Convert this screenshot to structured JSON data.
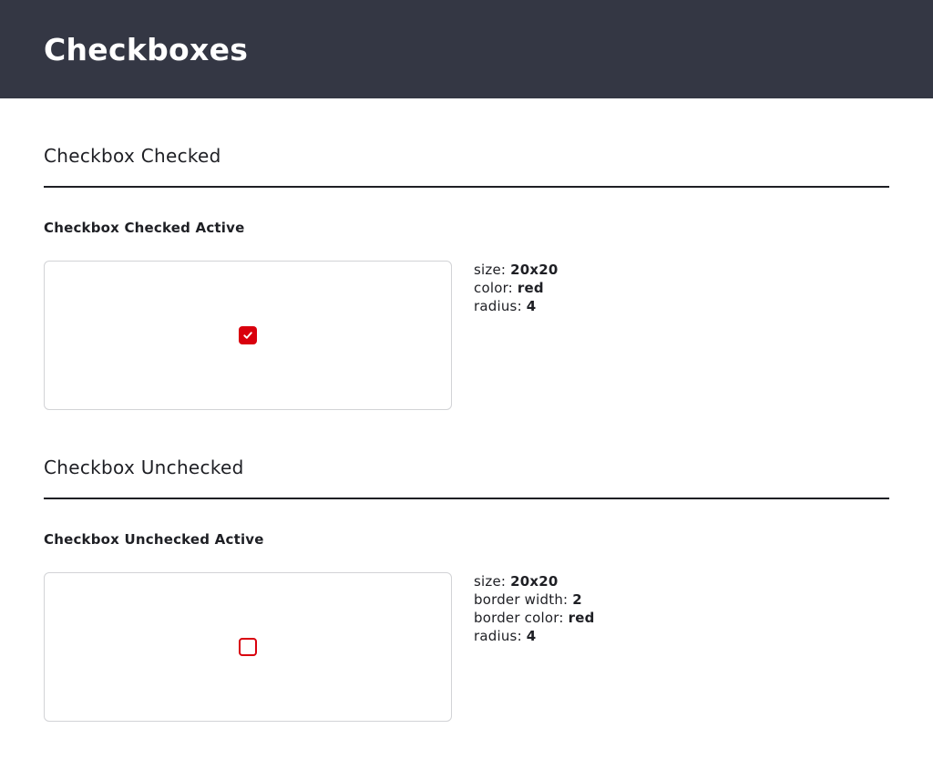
{
  "page": {
    "title": "Checkboxes"
  },
  "colors": {
    "header_bg": "#343744",
    "accent_red": "#d9000d",
    "text": "#1e1f24",
    "card_border": "#d2d3d6"
  },
  "sections": [
    {
      "title": "Checkbox Checked",
      "subsection": "Checkbox Checked Active",
      "checkbox": {
        "state": "checked",
        "icon": "checkmark-icon"
      },
      "specs": [
        {
          "label": "size:",
          "value": "20x20"
        },
        {
          "label": "color:",
          "value": "red"
        },
        {
          "label": "radius:",
          "value": "4"
        }
      ]
    },
    {
      "title": "Checkbox Unchecked",
      "subsection": "Checkbox Unchecked Active",
      "checkbox": {
        "state": "unchecked"
      },
      "specs": [
        {
          "label": "size:",
          "value": "20x20"
        },
        {
          "label": "border width:",
          "value": "2"
        },
        {
          "label": "border color:",
          "value": "red"
        },
        {
          "label": "radius:",
          "value": "4"
        }
      ]
    }
  ]
}
